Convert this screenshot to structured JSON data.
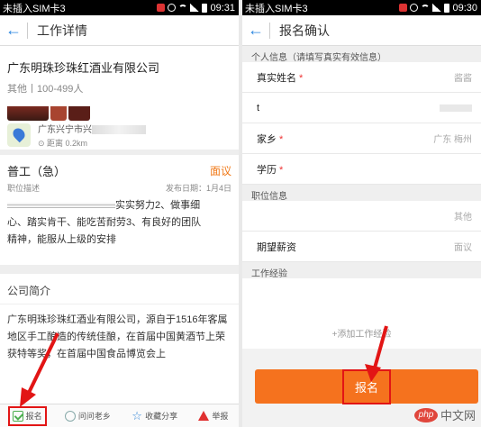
{
  "left": {
    "status": {
      "carrier": "未插入SIM卡3",
      "time": "09:31"
    },
    "title": "工作详情",
    "company": {
      "name": "广东明珠珍珠红酒业有限公司",
      "meta": "其他丨100-499人"
    },
    "location": {
      "address": "广东兴宁市兴",
      "distance": "距离 0.2km"
    },
    "job": {
      "title": "普工（急）",
      "salary": "面议",
      "desc_label": "职位描述",
      "date": "发布日期：1月4日",
      "desc_lines": [
        "实实努力2、做事细",
        "心、踏实肯干、能吃苦耐劳3、有良好的团队",
        "精神，能服从上级的安排"
      ]
    },
    "intro": {
      "title": "公司简介",
      "text": "广东明珠珍珠红酒业有限公司，源自于1516年客属地区手工酿造的传统佳酿，在首届中国黄酒节上荣获特等奖，在首届中国食品博览会上"
    },
    "bottom_bar": [
      {
        "label": "报名",
        "icon": "apply-icon"
      },
      {
        "label": "问问老乡",
        "icon": "ask-icon"
      },
      {
        "label": "收藏分享",
        "icon": "star-icon"
      },
      {
        "label": "举报",
        "icon": "warning-icon"
      }
    ]
  },
  "right": {
    "status": {
      "carrier": "未插入SIM卡3",
      "time": "09:30"
    },
    "title": "报名确认",
    "personal_header": "个人信息（请填写真实有效信息）",
    "fields": [
      {
        "label": "真实姓名",
        "required": "*",
        "value": "酱酱"
      },
      {
        "label": "t",
        "required": "",
        "value": ""
      },
      {
        "label": "家乡",
        "required": "*",
        "value": "广东 梅州"
      },
      {
        "label": "学历",
        "required": "*",
        "value": ""
      }
    ],
    "job_header": "职位信息",
    "job_fields": [
      {
        "label": "",
        "required": "",
        "value": "其他"
      },
      {
        "label": "期望薪资",
        "required": "",
        "value": "面议"
      }
    ],
    "exp_header": "工作经验",
    "add_exp": "+添加工作经验",
    "submit_label": "报名",
    "watermark": {
      "logo": "php",
      "text": "中文网"
    }
  },
  "colors": {
    "accent": "#f5721e",
    "highlight": "#e21515",
    "link": "#2a86e0"
  }
}
